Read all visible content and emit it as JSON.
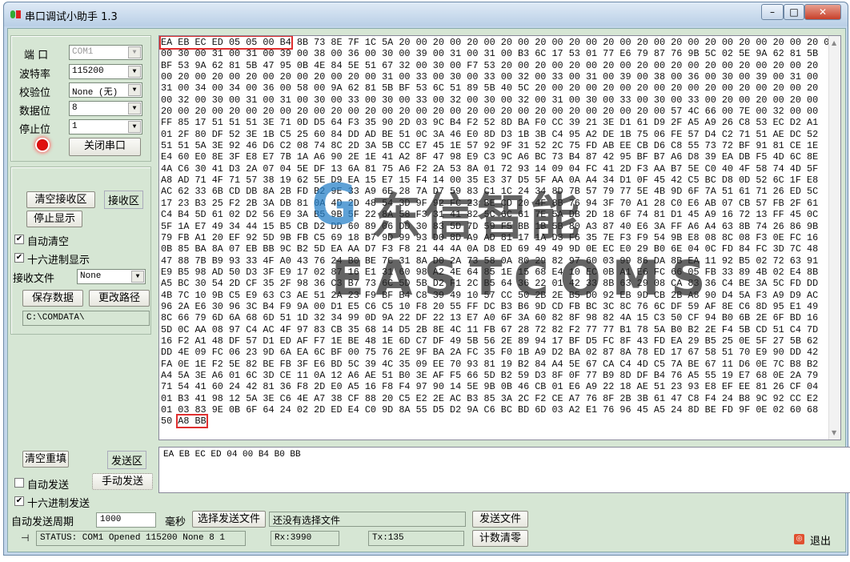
{
  "window": {
    "title": "串口调试小助手 1.3",
    "minimize": "–",
    "maximize": "□",
    "close": "✕"
  },
  "settings": {
    "port_label": "端  口",
    "port_value": "COM1",
    "baud_label": "波特率",
    "baud_value": "115200",
    "parity_label": "校验位",
    "parity_value": "None (无)",
    "databits_label": "数据位",
    "databits_value": "8",
    "stopbits_label": "停止位",
    "stopbits_value": "1",
    "status_led_color": "#e01010",
    "close_port_button": "关闭串口"
  },
  "receive": {
    "clear_button": "清空接收区",
    "area_label": "接收区",
    "stop_display_button": "停止显示",
    "auto_clear_label": "自动清空",
    "auto_clear_checked": true,
    "hex_display_label": "十六进制显示",
    "hex_display_checked": true,
    "file_label": "接收文件",
    "file_value": "None",
    "save_button": "保存数据",
    "change_path_button": "更改路径",
    "path": "C:\\COMDATA\\",
    "frame_header": "EA EB EC ED 05 05 00 B4",
    "first_line_rest": " 8B 73 8E 7F 1C 5A 20 00 20 00 20 00 20 00 20 00 20 00 20 00 20 00 20 00 20 00 20 00 20 00 20 00 32",
    "lines": [
      "00 30 00 31 00 31 00 39 00 38 00 36 00 30 00 39 00 31 00 31 00 B3 6C 17 53 01 77 E6 79 87 76 9B 5C 02 5E 9A 62 81 5B",
      "BF 53 9A 62 81 5B 47 95 0B 4E 84 5E 51 67 32 00 30 00 F7 53 20 00 20 00 20 00 20 00 20 00 20 00 20 00 20 00 20 00 20",
      "00 20 00 20 00 20 00 20 00 20 00 20 00 31 00 33 00 30 00 33 00 32 00 33 00 31 00 39 00 38 00 36 00 30 00 39 00 31 00",
      "31 00 34 00 34 00 36 00 58 00 9A 62 81 5B BF 53 6C 51 89 5B 40 5C 20 00 20 00 20 00 20 00 20 00 20 00 20 00 20 00 20",
      "00 32 00 30 00 31 00 31 00 30 00 33 00 30 00 33 00 32 00 30 00 32 00 31 00 30 00 33 00 30 00 33 00 20 00 20 00 20 00",
      "20 00 20 00 20 00 20 00 20 00 20 00 20 00 20 00 20 00 20 00 20 00 20 00 20 00 20 00 20 00 57 4C 66 00 7E 00 32 00 00",
      "FF 85 17 51 51 51 3E 71 0D D5 64 F3 35 90 2D 03 9C B4 F2 52 8D BA F0 CC 39 21 3E D1 61 D9 2F A5 A9 26 C8 53 EC D2 A1",
      "01 2F 80 DF 52 3E 1B C5 25 60 84 DD AD BE 51 0C 3A 46 E0 8D D3 1B 3B C4 95 A2 DE 1B 75 06 FE 57 D4 C2 71 51 AE DC 52",
      "51 51 5A 3E 92 46 D6 C2 08 74 8C 2D 3A 5B CC E7 45 1E 57 92 9F 31 52 2C 75 FD AB EE CB D6 C8 55 73 72 BF 91 81 CE 1E",
      "E4 60 E0 8E 3F E8 E7 7B 1A A6 90 2E 1E 41 A2 8F 47 98 E9 C3 9C A6 BC 73 B4 87 42 95 BF B7 A6 D8 39 EA DB F5 4D 6C 8E",
      "4A C6 30 41 D3 2A 07 04 5E DF 13 6A 81 75 A6 F2 2A 53 8A 01 72 93 14 09 04 FC 41 2D F3 AA B7 5E C0 40 4F 58 74 4D 5F",
      "A8 AD 71 4F 71 57 38 19 62 5E D9 EA 15 E7 15 F4 14 00 35 E3 37 D5 5F AA 0A A4 34 D1 0F 45 42 C5 BC D8 0D 52 6C 1F E8",
      "AC 62 33 6B CD DB 8A 2B FD B2 9E 33 A9 6E 28 7A D7 59 83 C1 1C 24 34 8D 7B 57 79 77 5E 4B 9D 6F 7A 51 61 71 26 ED 5C",
      "17 23 B3 25 F2 2B 3A DB 81 0A 4D 2D 48 54 3D 9F 92 FC 23 BE CD 20 4F 8B 76 94 3F 70 A1 28 C0 E6 AB 07 CB 57 FB 2F 61",
      "C4 B4 5D 61 02 D2 56 E9 3A B5 9B 5F 22 8A 58 F3 31 41 82 5C 6C 61 7E 5A DB 2D 18 6F 74 81 D1 45 A9 16 72 13 FF 45 0C",
      "5F 1A E7 49 34 44 15 B5 CB D2 DD 60 89 06 DD 30 83 5D 7D 59 F5 BB 1B 5B 80 A3 87 40 E6 3A FF A6 A4 63 8B 74 26 86 9B",
      "79 FB A1 20 EF 92 5D 9B FB C5 69 18 B7 9D 99 93 D0 8D A9 AD 81 17 1A D3 F6 35 7E F3 F9 54 9B E8 08 8C 08 F3 0E FC 16",
      "0B 85 BA 8A 07 EB BB 9C B2 5D EA AA D7 F3 F8 21 44 4A 0A D8 ED 69 49 49 9D 0E EC E0 29 B0 6E 04 0C FD 84 FC 3D 7C 48",
      "47 88 7B B9 93 33 4F A0 43 76 24 B0 BE 7C 31 8A D0 2A 73 58 0A 80 29 82 97 60 03 99 86 DA 8B EA 11 92 B5 02 72 63 91",
      "E9 B5 98 AD 50 D3 3F E9 17 02 87 16 E1 31 60 98 A2 4E 64 85 1E 15 68 E4 10 EC 0B A1 E6 FC 66 05 FB 33 89 4B 02 E4 8B",
      "A5 BC 30 54 2D CF 35 2F 98 36 C3 B7 73 6C 5D 5B D2 F1 2C B5 64 36 22 01 42 33 8B 63 29 08 CA 83 36 C4 BE 3A 5C FD DD",
      "4B 7C 10 9B C5 E9 63 C3 AE 51 2A 23 F9 BF B4 C8 39 49 10 57 CC 50 2B 2E B5 D0 92 EB 9D CB 2B A8 90 D4 5A F3 A9 D9 AC",
      "96 2A E6 30 96 3C B4 F9 9A 00 D1 E5 C6 C5 10 F8 20 55 FF DC B3 B6 9D CD FB BC 3C 8C 76 6C DF 59 AF 8E C6 8D 95 E1 49",
      "8C 66 79 6D 6A 68 6D 51 1D 32 34 99 0D 9A 22 DF 22 13 E7 A0 6F 3A 60 82 8F 98 82 4A 15 C3 50 CF 94 B0 6B 2E 6F BD 16",
      "5D 0C AA 08 97 C4 AC 4F 97 83 CB 35 68 14 D5 2B 8E 4C 11 FB 67 28 72 82 F2 77 77 B1 78 5A B0 B2 2E F4 5B CD 51 C4 7D",
      "16 F2 A1 48 DF 57 D1 ED AF F7 1E BE 48 1E 6D C7 DF 49 5B 56 2E 89 94 17 BF D5 FC 8F 43 FD EA 29 B5 25 0E 5F 27 5B 62",
      "DD 4E 09 FC 06 23 9D 6A EA 6C BF 00 75 76 2E 9F BA 2A FC 35 F0 1B A9 D2 BA 02 87 8A 78 ED 17 67 58 51 70 E9 90 DD 42",
      "FA 0E 1E F2 5E 82 BE FB 3F E6 BD 5C 39 4C 35 09 EE 70 93 81 19 B2 84 A4 5E 67 CA C4 4D C5 7A BE 67 11 D6 0E 7C B8 B2",
      "A4 5A 3E A6 01 6C 3D CE 11 0A 12 A6 AE 51 B0 3E AF F5 66 5D B2 59 D3 8F 0F 77 B9 8D DF B4 76 A5 55 19 E7 68 0E 2A 79",
      "71 54 41 60 24 42 81 36 F8 2D E0 A5 16 F8 F4 97 90 14 5E 9B 0B 46 CB 01 E6 A9 22 18 AE 51 23 93 E8 EF EE 81 26 CF 04",
      "01 B3 41 98 12 5A 3E C6 4E A7 38 CF 88 20 C5 E2 2E AC B3 85 3A 2C F2 CE A7 76 8F 2B 3B 61 47 C8 F4 24 B8 9C 92 CC E2",
      "01 03 83 9E 0B 6F 64 24 02 2D ED E4 C0 9D 8A 55 D5 D2 9A C6 BC BD 6D 03 A2 E1 76 96 45 A5 24 8D BE FD 9F 0E 02 60 68"
    ],
    "last_line_prefix": "50 ",
    "frame_tail": "A8 BB"
  },
  "watermark": {
    "cn": "东信智能",
    "en": "EASTCOMS"
  },
  "send": {
    "clear_button": "清空重填",
    "area_label": "发送区",
    "text": "EA EB EC ED 04 00 B4 B0 BB",
    "auto_send_label": "自动发送",
    "auto_send_checked": false,
    "manual_send_button": "手动发送",
    "hex_send_label": "十六进制发送",
    "hex_send_checked": true,
    "period_label": "自动发送周期",
    "period_value": "1000",
    "period_unit": "毫秒",
    "choose_file_button": "选择发送文件",
    "file_status": "还没有选择文件",
    "send_file_button": "发送文件"
  },
  "status": {
    "text": "STATUS: COM1 Opened 115200 None  8 1",
    "rx": "Rx:3990",
    "tx": "Tx:135",
    "reset_counter_button": "计数清零",
    "exit_button": "退出"
  }
}
